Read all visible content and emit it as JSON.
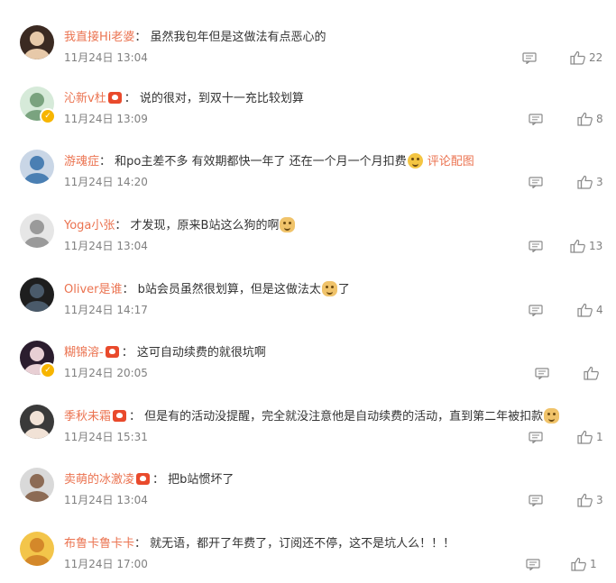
{
  "comments": [
    {
      "user": "我直接Hi老婆",
      "vip": false,
      "segments": [
        {
          "t": "虽然我包年但是这做法有点恶心的"
        }
      ],
      "time": "11月24日 13:04",
      "likes": "22"
    },
    {
      "user": "沁新v杜",
      "vip": true,
      "segments": [
        {
          "t": "说的很对，到双十一充比较划算"
        }
      ],
      "time": "11月24日 13:09",
      "likes": "8"
    },
    {
      "user": "游魂症",
      "vip": false,
      "segments": [
        {
          "t": "和po主差不多 有效期都快一年了 还在一个月一个月扣费"
        },
        {
          "emo": "grin"
        },
        {
          "link": "评论配图"
        }
      ],
      "time": "11月24日 14:20",
      "likes": "3"
    },
    {
      "user": "Yoga小张",
      "vip": false,
      "segments": [
        {
          "t": "才发现，原来B站这么狗的啊"
        },
        {
          "emo": "doge"
        }
      ],
      "time": "11月24日 13:04",
      "likes": "13"
    },
    {
      "user": "Oliver是谁",
      "vip": false,
      "segments": [
        {
          "t": "b站会员虽然很划算，但是这做法太"
        },
        {
          "emo": "doge"
        },
        {
          "t": "了"
        }
      ],
      "time": "11月24日 14:17",
      "likes": "4"
    },
    {
      "user": "糊锦溶-",
      "vip": true,
      "segments": [
        {
          "t": "这可自动续费的就很坑啊"
        }
      ],
      "time": "11月24日 20:05",
      "likes": ""
    },
    {
      "user": "季秋未霜",
      "vip": true,
      "segments": [
        {
          "t": "但是有的活动没提醒，完全就没注意他是自动续费的活动，直到第二年被扣款"
        },
        {
          "emo": "doge"
        }
      ],
      "time": "11月24日 15:31",
      "likes": "1"
    },
    {
      "user": "卖萌的冰激凌",
      "vip": true,
      "segments": [
        {
          "t": "把b站惯坏了"
        }
      ],
      "time": "11月24日 13:04",
      "likes": "3"
    },
    {
      "user": "布鲁卡鲁卡卡",
      "vip": false,
      "segments": [
        {
          "t": "就无语，都开了年费了，订阅还不停，这不是坑人么！！！"
        }
      ],
      "time": "11月24日 17:00",
      "likes": "1"
    }
  ],
  "colors": {
    "username": "#eb7350",
    "text": "#333333",
    "meta": "#808080",
    "verified": "#f7b500"
  },
  "icons": {
    "comment": "comment-icon",
    "like": "thumbs-up-icon",
    "vip": "vip-heart-icon"
  }
}
